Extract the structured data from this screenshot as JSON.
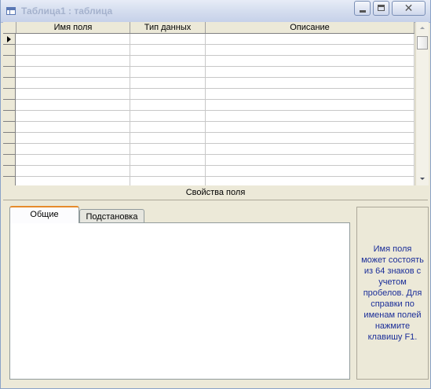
{
  "window": {
    "title": "Таблица1 : таблица"
  },
  "grid": {
    "columns": [
      {
        "label": "Имя поля"
      },
      {
        "label": "Тип данных"
      },
      {
        "label": "Описание"
      }
    ],
    "row_count": 14,
    "current_row": 0
  },
  "properties": {
    "section_label": "Свойства поля",
    "tabs": [
      {
        "label": "Общие",
        "active": true
      },
      {
        "label": "Подстановка",
        "active": false
      }
    ],
    "help_text": "Имя поля может состоять из 64 знаков с учетом пробелов. Для справки по именам полей нажмите клавишу F1."
  },
  "colors": {
    "help_text": "#1b2e99",
    "active_tab_accent": "#e68b2c",
    "title_text": "#a5b2cd"
  },
  "icons": {
    "window": "table-icon",
    "minimize": "minimize-icon",
    "maximize": "restore-icon",
    "close": "close-icon"
  }
}
